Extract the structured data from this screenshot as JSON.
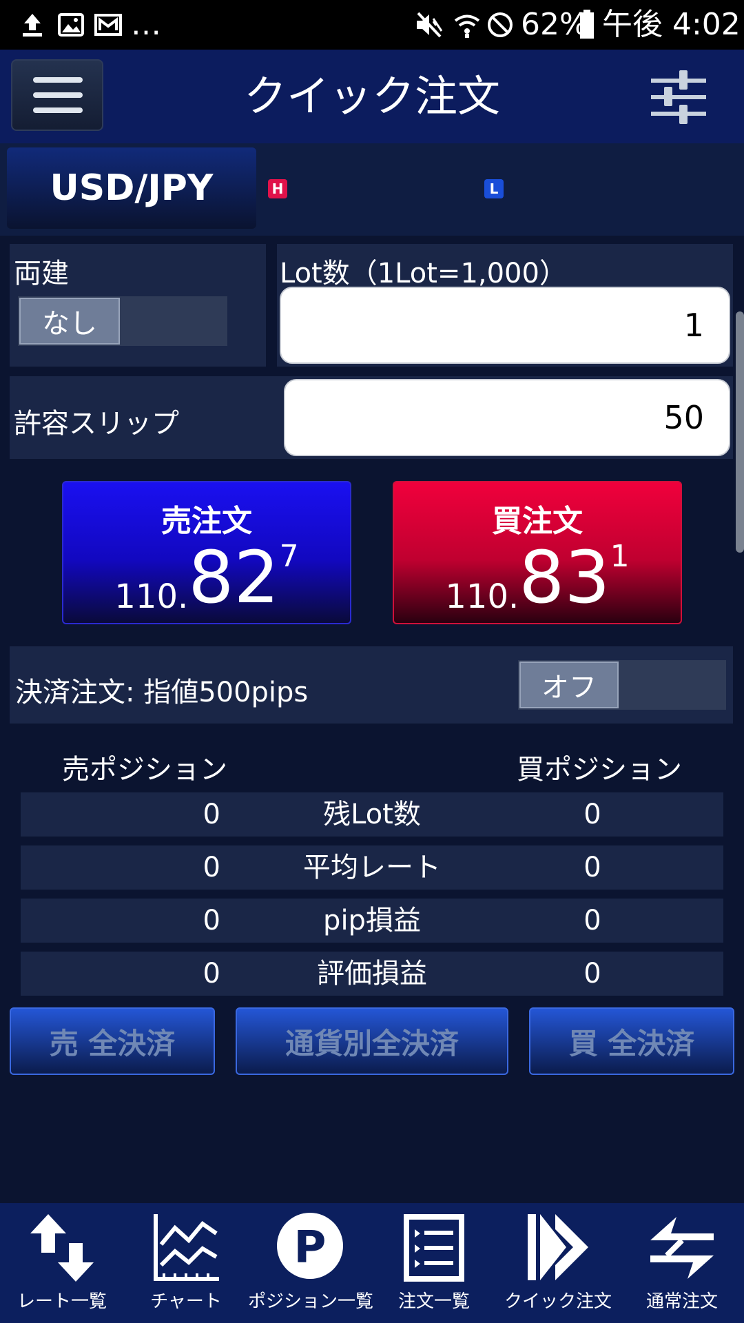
{
  "status_bar": {
    "overflow": "…",
    "battery": "62%",
    "time": "午後 4:02"
  },
  "header": {
    "title": "クイック注文"
  },
  "currency": {
    "pair": "USD/JPY",
    "high_badge": "H",
    "low_badge": "L"
  },
  "hedge": {
    "label": "両建",
    "value": "なし"
  },
  "lot": {
    "label": "Lot数（1Lot=1,000）",
    "value": "1"
  },
  "slippage": {
    "label": "許容スリップ",
    "value": "50"
  },
  "sell_order": {
    "label": "売注文",
    "price_prefix": "110.",
    "price_main": "82",
    "price_sup": "7"
  },
  "buy_order": {
    "label": "買注文",
    "price_prefix": "110.",
    "price_main": "83",
    "price_sup": "1"
  },
  "settlement": {
    "label": "決済注文: 指値500pips",
    "toggle": "オフ"
  },
  "positions": {
    "sell_header": "売ポジション",
    "buy_header": "買ポジション",
    "rows": [
      {
        "label": "残Lot数",
        "sell": "0",
        "buy": "0"
      },
      {
        "label": "平均レート",
        "sell": "0",
        "buy": "0"
      },
      {
        "label": "pip損益",
        "sell": "0",
        "buy": "0"
      },
      {
        "label": "評価損益",
        "sell": "0",
        "buy": "0"
      }
    ]
  },
  "settle_buttons": {
    "sell_all": "売 全決済",
    "currency_all": "通貨別全決済",
    "buy_all": "買 全決済"
  },
  "bottom_nav": [
    {
      "label": "レート一覧",
      "icon": "rate-list-icon"
    },
    {
      "label": "チャート",
      "icon": "chart-icon"
    },
    {
      "label": "ポジション一覧",
      "icon": "position-list-icon"
    },
    {
      "label": "注文一覧",
      "icon": "order-list-icon"
    },
    {
      "label": "クイック注文",
      "icon": "quick-order-icon"
    },
    {
      "label": "通常注文",
      "icon": "normal-order-icon"
    }
  ],
  "colors": {
    "sell": "#1a10f0",
    "buy": "#e8003c",
    "background": "#0b1430",
    "header": "#0c1c5e"
  }
}
